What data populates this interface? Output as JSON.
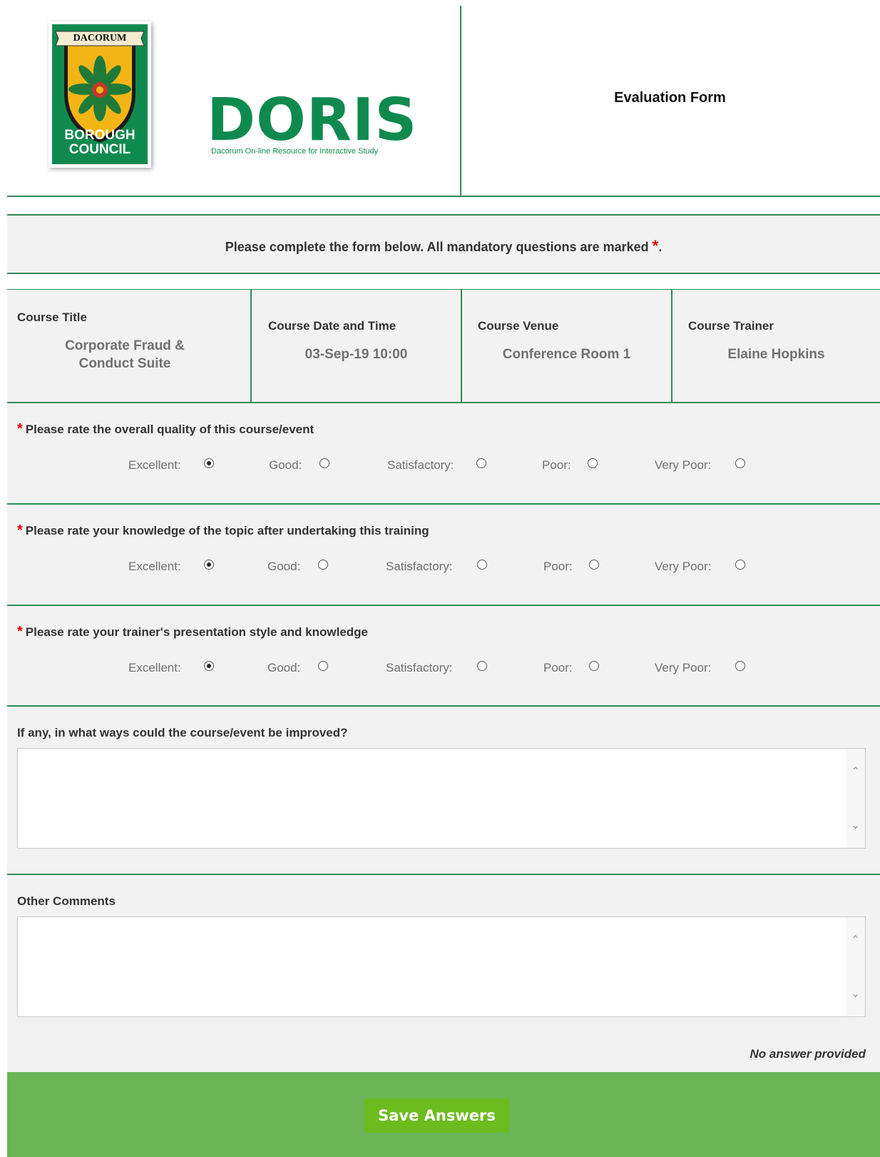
{
  "header": {
    "council_logo": {
      "top_text": "DACORUM",
      "bottom_line1": "BOROUGH",
      "bottom_line2": "COUNCIL"
    },
    "doris_logo": {
      "title": "DORIS",
      "subtitle": "Dacorum On-line Resource for Interactive Study"
    },
    "form_title": "Evaluation Form"
  },
  "instruction": {
    "text": "Please complete the form below. All mandatory questions are marked ",
    "star": "*",
    "end": "."
  },
  "course": {
    "title_label": "Course Title",
    "title_line1": "Corporate Fraud &",
    "title_line2": "Conduct Suite",
    "date_label": "Course Date and Time",
    "date_value": "03-Sep-19 10:00",
    "venue_label": "Course Venue",
    "venue_value": "Conference Room 1",
    "trainer_label": "Course Trainer",
    "trainer_value": "Elaine Hopkins"
  },
  "questions": [
    {
      "star": "*",
      "text": "Please rate the overall quality of this course/event",
      "options": [
        "Excellent:",
        "Good:",
        "Satisfactory:",
        "Poor:",
        "Very Poor:"
      ],
      "selected": "Excellent:"
    },
    {
      "star": "*",
      "text": "Please rate your knowledge of the topic after undertaking this training",
      "options": [
        "Excellent:",
        "Good:",
        "Satisfactory:",
        "Poor:",
        "Very Poor:"
      ],
      "selected": "Excellent:"
    },
    {
      "star": "*",
      "text": "Please rate your trainer's presentation style and knowledge",
      "options": [
        "Excellent:",
        "Good:",
        "Satisfactory:",
        "Poor:",
        "Very Poor:"
      ],
      "selected": "Excellent:"
    }
  ],
  "improve": {
    "label": "If any, in what ways could the course/event be improved?",
    "value": ""
  },
  "comments": {
    "label": "Other Comments",
    "value": "",
    "status": "No answer provided"
  },
  "footer": {
    "save_label": "Save Answers"
  },
  "colors": {
    "divider": "#2e8b57",
    "logo_green": "#0f8a4f",
    "footer_green": "#6ab657",
    "button_green": "#6cbc1f",
    "required_red": "#e60000"
  }
}
